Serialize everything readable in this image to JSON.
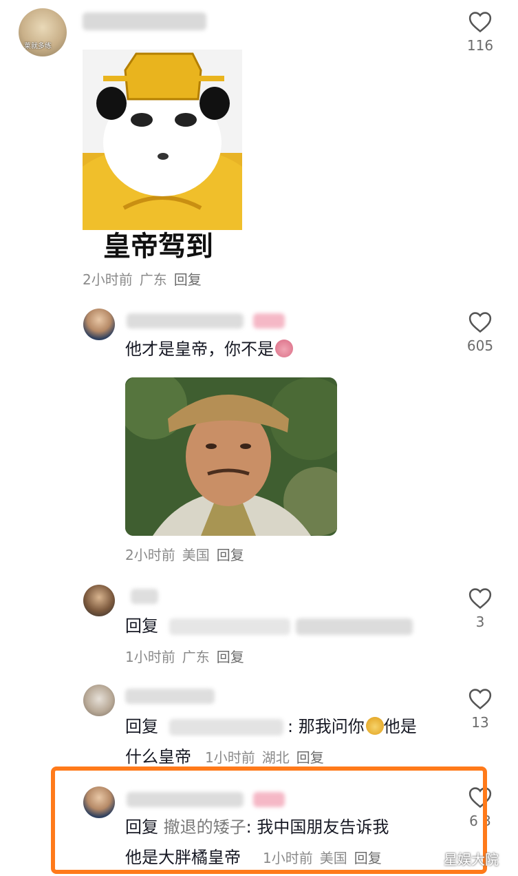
{
  "comments": [
    {
      "sticker_caption": "皇帝驾到",
      "meta": {
        "time": "2小时前",
        "location": "广东",
        "reply": "回复"
      },
      "likes": "116"
    },
    {
      "text": "他才是皇帝，你不是",
      "meta": {
        "time": "2小时前",
        "location": "美国",
        "reply": "回复"
      },
      "likes": "605"
    },
    {
      "text_prefix": "回复",
      "meta": {
        "time": "1小时前",
        "location": "广东",
        "reply": "回复"
      },
      "likes": "3"
    },
    {
      "text_prefix": "回复",
      "text_after_mention": ": 那我问你",
      "text_suffix": "他是",
      "text_line2": "什么皇帝",
      "meta": {
        "time": "1小时前",
        "location": "湖北",
        "reply": "回复"
      },
      "likes": "13"
    },
    {
      "text_prefix": "回复",
      "mention": "撤退的矮子",
      "text_after_mention": ": 我中国朋友告诉我",
      "text_line2": "他是大胖橘皇帝",
      "meta": {
        "time": "1小时前",
        "location": "美国",
        "reply": "回复"
      },
      "likes": "6 3"
    }
  ],
  "avatar_text": "莱就多练",
  "watermark": "星娱大院",
  "colors": {
    "highlight": "#ff7a1a",
    "meta": "#8a8a8a",
    "text": "#161823"
  }
}
